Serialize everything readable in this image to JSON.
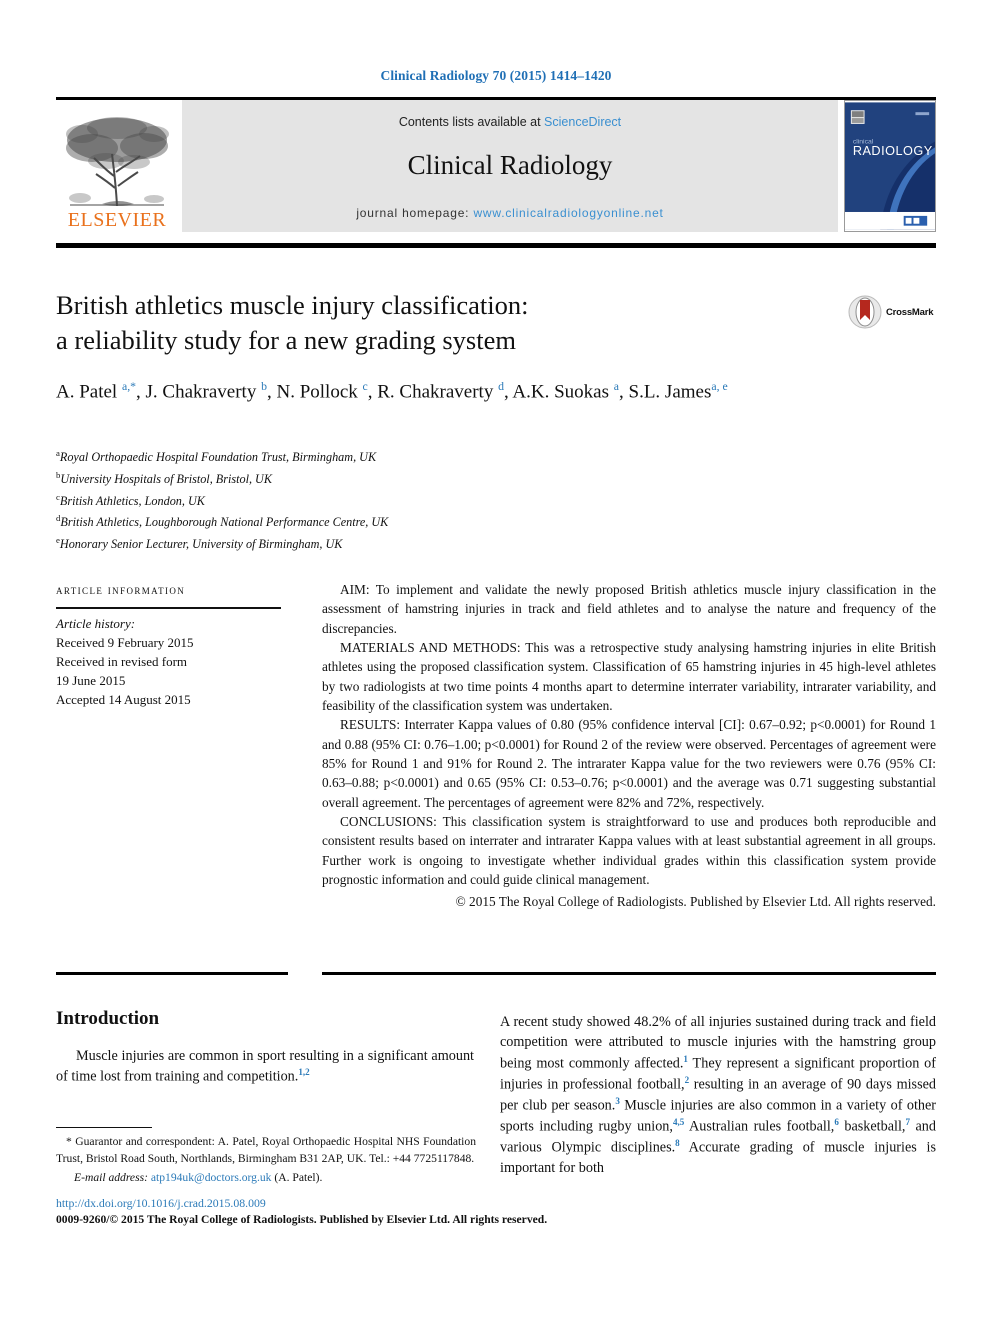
{
  "running_head": "Clinical Radiology 70 (2015) 1414–1420",
  "masthead": {
    "publisher_logo_label": "ELSEVIER",
    "contents_prefix": "Contents lists available at ",
    "contents_link": "ScienceDirect",
    "journal_name": "Clinical Radiology",
    "homepage_prefix": "journal homepage: ",
    "homepage_url": "www.clinicalradiologyonline.net",
    "cover_title_line1": "clinical",
    "cover_title_line2": "RADIOLOGY",
    "colors": {
      "link": "#3a8fd0",
      "elsevier_orange": "#E9711C",
      "band_gray": "#e4e4e4",
      "cover_blue": "#1f3f7a"
    }
  },
  "article": {
    "title_line1": "British athletics muscle injury classification:",
    "title_line2": "a reliability study for a new grading system",
    "crossmark_label": "CrossMark",
    "authors_html": "A. Patel <sup>a,</sup><sup class=\"star\">*</sup>, J. Chakraverty <sup>b</sup>, N. Pollock <sup>c</sup>, R. Chakraverty <sup>d</sup>, A.K. Suokas <sup>a</sup>, S.L. James<sup>a, e</sup>",
    "affiliations": [
      {
        "marker": "a",
        "text": "Royal Orthopaedic Hospital Foundation Trust, Birmingham, UK"
      },
      {
        "marker": "b",
        "text": "University Hospitals of Bristol, Bristol, UK"
      },
      {
        "marker": "c",
        "text": "British Athletics, London, UK"
      },
      {
        "marker": "d",
        "text": "British Athletics, Loughborough National Performance Centre, UK"
      },
      {
        "marker": "e",
        "text": "Honorary Senior Lecturer, University of Birmingham, UK"
      }
    ]
  },
  "article_information": {
    "heading": "article information",
    "history_label": "Article history:",
    "history_lines": [
      "Received 9 February 2015",
      "Received in revised form",
      "19 June 2015",
      "Accepted 14 August 2015"
    ]
  },
  "abstract": {
    "aim": "AIM: To implement and validate the newly proposed British athletics muscle injury classification in the assessment of hamstring injuries in track and field athletes and to analyse the nature and frequency of the discrepancies.",
    "materials_and_methods": "MATERIALS AND METHODS: This was a retrospective study analysing hamstring injuries in elite British athletes using the proposed classification system. Classification of 65 hamstring injuries in 45 high-level athletes by two radiologists at two time points 4 months apart to determine interrater variability, intrarater variability, and feasibility of the classification system was undertaken.",
    "results": "RESULTS: Interrater Kappa values of 0.80 (95% confidence interval [CI]: 0.67–0.92; p<0.0001) for Round 1 and 0.88 (95% CI: 0.76–1.00; p<0.0001) for Round 2 of the review were observed. Percentages of agreement were 85% for Round 1 and 91% for Round 2. The intrarater Kappa value for the two reviewers were 0.76 (95% CI: 0.63–0.88; p<0.0001) and 0.65 (95% CI: 0.53–0.76; p<0.0001) and the average was 0.71 suggesting substantial overall agreement. The percentages of agreement were 82% and 72%, respectively.",
    "conclusions": "CONCLUSIONS: This classification system is straightforward to use and produces both reproducible and consistent results based on interrater and intrarater Kappa values with at least substantial agreement in all groups. Further work is ongoing to investigate whether individual grades within this classification system provide prognostic information and could guide clinical management.",
    "copyright": "© 2015 The Royal College of Radiologists. Published by Elsevier Ltd. All rights reserved."
  },
  "body": {
    "introduction_heading": "Introduction",
    "left_paragraph_html": "Muscle injuries are common in sport resulting in a significant amount of time lost from training and competition.<sup>1,2</sup>",
    "right_paragraph_html": "A recent study showed 48.2% of all injuries sustained during track and field competition were attributed to muscle injuries with the hamstring group being most commonly affected.<sup>1</sup> They represent a significant proportion of injuries in professional football,<sup>2</sup> resulting in an average of 90 days missed per club per season.<sup>3</sup> Muscle injuries are also common in a variety of other sports including rugby union,<sup>4,5</sup> Australian rules football,<sup>6</sup> basketball,<sup>7</sup> and various Olympic disciplines.<sup>8</sup> Accurate grading of muscle injuries is important for both"
  },
  "footnote": {
    "correspondence_html": "* Guarantor and correspondent: A. Patel, Royal Orthopaedic Hospital NHS Foundation Trust, Bristol Road South, Northlands, Birmingham B31 2AP, UK. Tel.: +44 7725117848.",
    "email_label": "E-mail address:",
    "email": "atp194uk@doctors.org.uk",
    "email_owner": "(A. Patel).",
    "doi": "http://dx.doi.org/10.1016/j.crad.2015.08.009",
    "issn_line": "0009-9260/© 2015 The Royal College of Radiologists. Published by Elsevier Ltd. All rights reserved."
  }
}
